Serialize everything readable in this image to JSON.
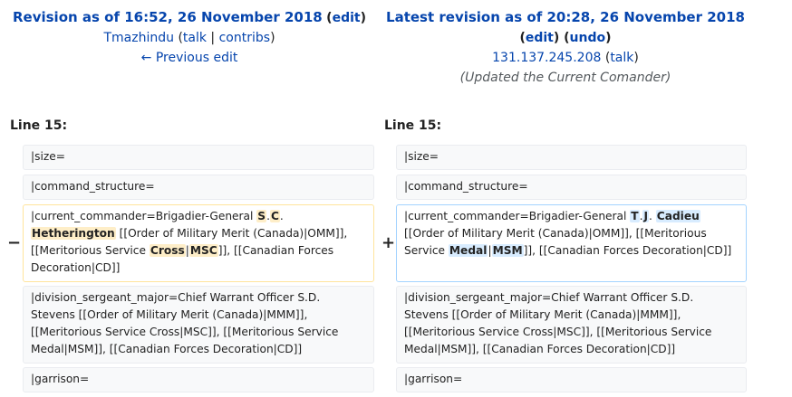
{
  "left_header": {
    "title": "Revision as of 16:52, 26 November 2018",
    "edit": "edit",
    "user": "Tmazhindu",
    "talk": "talk",
    "contribs": "contribs",
    "prev": "← Previous edit"
  },
  "right_header": {
    "title": "Latest revision as of 20:28, 26 November 2018",
    "edit": "edit",
    "undo": "undo",
    "user": "131.137.245.208",
    "talk": "talk",
    "comment": "(Updated the Current Comander)"
  },
  "line_left": "Line 15:",
  "line_right": "Line 15:",
  "markers": {
    "minus": "−",
    "plus": "+"
  },
  "rows": {
    "size": "|size=",
    "command_structure": "|command_structure=",
    "division_sergeant_major": "|division_sergeant_major=Chief Warrant Officer S.D. Stevens [[Order of Military Merit (Canada)|MMM]], [[Meritorious Service Cross|MSC]], [[Meritorious Service Medal|MSM]], [[Canadian Forces Decoration|CD]]",
    "garrison": "|garrison="
  },
  "deleted": {
    "p1": "|current_commander=Brigadier-General ",
    "h1": "S",
    "p2": ".",
    "h2": "C",
    "p3": ". ",
    "h3": "Hetherington",
    "p4": " [[Order of Military Merit (Canada)|OMM]], [[Meritorious Service ",
    "h4": "Cross",
    "p5": "|",
    "h5": "MSC",
    "p6": "]], [[Canadian Forces Decoration|CD]]"
  },
  "added": {
    "p1": "|current_commander=Brigadier-General ",
    "h1": "T",
    "p2": ".",
    "h2": "J",
    "p3": ". ",
    "h3": "Cadieu",
    "p4": " [[Order of Military Merit (Canada)|OMM]], [[Meritorious Service ",
    "h4": "Medal",
    "p5": "|",
    "h5": "MSM",
    "p6": "]], [[Canadian Forces Decoration|CD]]"
  }
}
